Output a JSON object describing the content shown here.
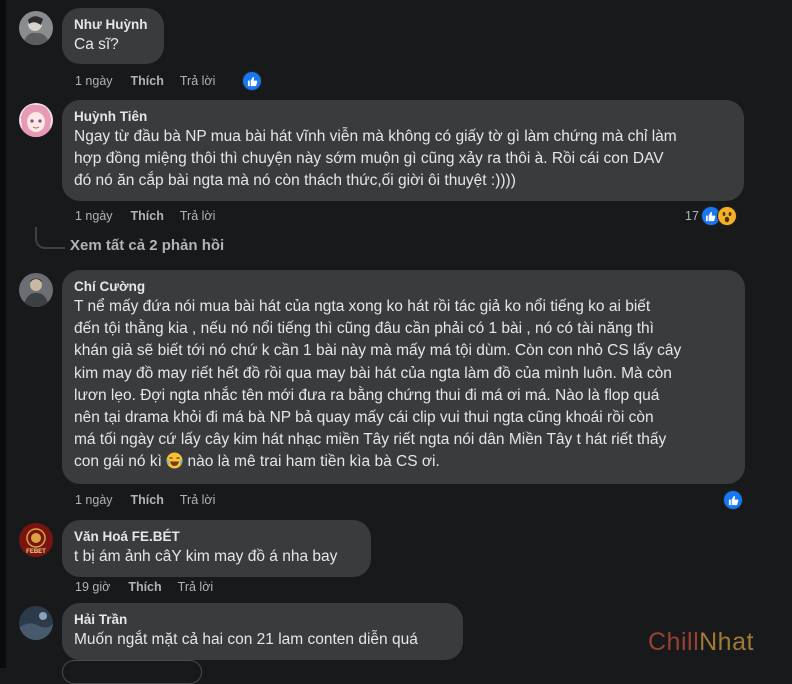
{
  "comments": [
    {
      "author": "Như Huỳnh",
      "text": "Ca sĩ?",
      "time": "1 ngày",
      "like": "Thích",
      "reply": "Trả lời"
    },
    {
      "author": "Huỳnh Tiên",
      "text": "Ngay từ đầu bà NP mua bài hát vĩnh viễn mà không có giấy tờ gì làm chứng mà chỉ làm\nhợp đồng miệng thôi thì chuyện này sớm muộn gì cũng xảy ra thôi à. Rồi cái con DAV\nđó nó ăn cắp bài ngta mà nó còn thách thức,ối giời ôi thuyệt :))))",
      "time": "1 ngày",
      "like": "Thích",
      "reply": "Trả lời",
      "reaction_count": "17"
    },
    {
      "author": "Chí Cường",
      "text_before_emoji": "T nể mấy đứa nói mua bài hát của ngta xong ko hát rồi tác giả ko nổi tiếng ko ai biết\nđến tội thằng kia , nếu nó nổi tiếng thì cũng đâu cần phải có 1 bài , nó có tài năng thì\nkhán giả sẽ biết tới nó chứ k cần 1 bài này mà mấy má tội dùm. Còn con nhỏ CS lấy cây\nkim may đồ may riết hết đồ rồi qua may bài hát của ngta làm đồ của mình luôn. Mà còn\nlươn lẹo. Đợi ngta nhắc tên mới đưa ra bằng chứng thui đi má ơi má. Nào là flop quá\nnên tại drama khỏi đi má bà NP bả quay mấy cái clip vui thui ngta cũng khoái rồi còn\nmá tối ngày cứ lấy cây kim hát nhạc miền Tây riết ngta nói dân Miền Tây t hát riết thấy\ncon gái nó kì ",
      "text_after_emoji": " nào là mê trai ham tiền kìa bà CS ơi.",
      "time": "1 ngày",
      "like": "Thích",
      "reply": "Trả lời"
    },
    {
      "author": "Văn Hoá FE.BÉT",
      "text": "t bị ám ảnh câY kim may đồ á nha bay",
      "time": "19 giờ",
      "like": "Thích",
      "reply": "Trả lời",
      "avatar_text": "FEBET"
    },
    {
      "author": "Hải Trần",
      "text": "Muốn ngắt mặt cả hai con 21 lam conten diễn quá"
    }
  ],
  "see_replies": "Xem tất cả 2 phản hồi",
  "watermark": {
    "part1": "Chill",
    "part2": "Nhat"
  },
  "colors": {
    "background": "#18191a",
    "bubble": "#3a3b3c",
    "like_blue": "#1877f2",
    "wow_yellow": "#f7b125"
  }
}
